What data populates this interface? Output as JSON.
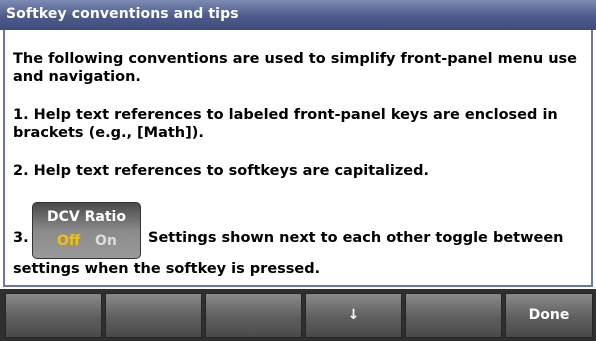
{
  "title": "Softkey conventions and tips",
  "paragraphs": {
    "intro": "The following conventions are used to simplify front-panel menu use and navigation.",
    "item1": "1. Help text references to labeled front-panel keys are enclosed in brackets (e.g., [Math]).",
    "item2": "2. Help text references to softkeys are capitalized.",
    "item3_number": "3.",
    "item3_text": "Settings shown next to each other toggle between",
    "item3_continued": "settings when the softkey is pressed."
  },
  "demo_softkey": {
    "name": "DCV Ratio",
    "option_off": "Off",
    "option_on": "On",
    "selected": "Off",
    "selected_color": "#f7c100"
  },
  "softkeys": {
    "key1": "",
    "key2": "",
    "key3": "",
    "key4": "↓",
    "key5": "",
    "key6": "Done"
  },
  "colors": {
    "title_bar": "#4d5b8c",
    "panel_border": "#6c77a0",
    "softkey": "#5e5e5e"
  }
}
